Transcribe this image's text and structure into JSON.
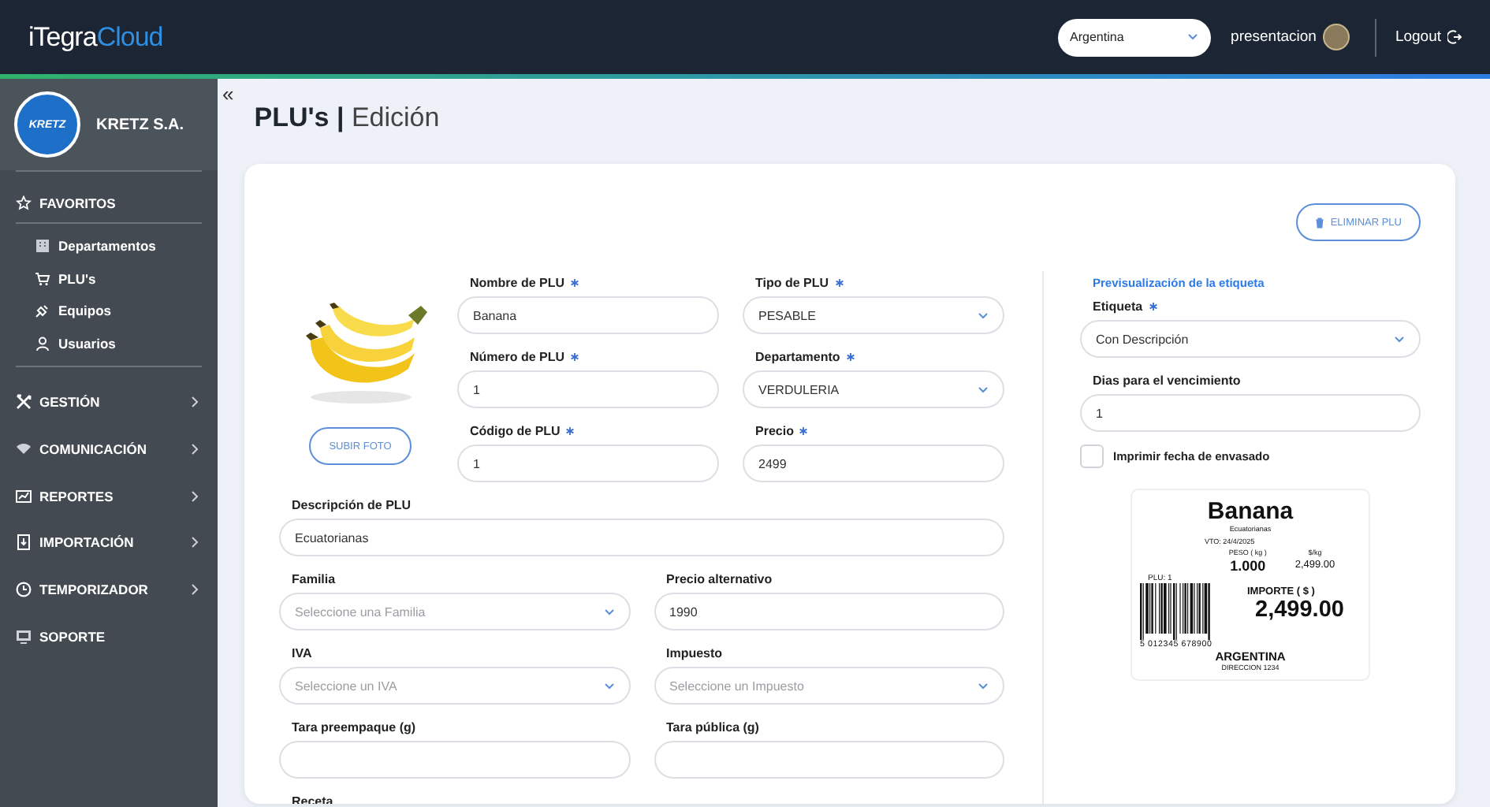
{
  "header": {
    "logo": {
      "primary": "iTegra",
      "secondary": "Cloud"
    },
    "country_select": {
      "value": "Argentina"
    },
    "user": {
      "name": "presentacion"
    },
    "logout": "Logout"
  },
  "sidebar": {
    "company": {
      "badge": "KRETZ",
      "name": "KRETZ S.A."
    },
    "favorites": {
      "title": "FAVORITOS",
      "items": [
        {
          "label": "Departamentos"
        },
        {
          "label": "PLU's"
        },
        {
          "label": "Equipos"
        },
        {
          "label": "Usuarios"
        }
      ]
    },
    "menu": [
      {
        "label": "GESTIÓN",
        "kind": "group"
      },
      {
        "label": "COMUNICACIÓN",
        "kind": "group"
      },
      {
        "label": "REPORTES",
        "kind": "group"
      },
      {
        "label": "IMPORTACIÓN",
        "kind": "group"
      },
      {
        "label": "TEMPORIZADOR",
        "kind": "group"
      },
      {
        "label": "SOPORTE",
        "kind": "link"
      }
    ]
  },
  "page": {
    "collapse_toggle": "«",
    "title": "PLU's |",
    "subtitle": "Edición"
  },
  "form": {
    "delete_button": "ELIMINAR PLU",
    "upload_button": "SUBIR FOTO",
    "fields": [
      {
        "label": "Nombre de PLU",
        "required": true,
        "kind": "input",
        "value": "Banana"
      },
      {
        "label": "Tipo de PLU",
        "required": true,
        "kind": "select",
        "value": "PESABLE"
      },
      {
        "label": "Número de PLU",
        "required": true,
        "kind": "input",
        "value": "1"
      },
      {
        "label": "Departamento",
        "required": true,
        "kind": "select",
        "value": "VERDULERIA"
      },
      {
        "label": "Código de PLU",
        "required": true,
        "kind": "input",
        "value": "1"
      },
      {
        "label": "Precio",
        "required": true,
        "kind": "input",
        "value": "2499"
      }
    ],
    "description": {
      "label": "Descripción de PLU",
      "required": false,
      "kind": "input",
      "value": "Ecuatorianas"
    },
    "details": [
      {
        "label": "Familia",
        "required": false,
        "kind": "select",
        "placeholder": "Seleccione una Familia"
      },
      {
        "label": "Precio alternativo",
        "required": false,
        "kind": "input",
        "value": "1990"
      },
      {
        "label": "IVA",
        "required": false,
        "kind": "select",
        "placeholder": "Seleccione un IVA"
      },
      {
        "label": "Impuesto",
        "required": false,
        "kind": "select",
        "placeholder": "Seleccione un Impuesto"
      },
      {
        "label": "Tara preempaque (g)",
        "required": false,
        "kind": "input"
      },
      {
        "label": "Tara pública (g)",
        "required": false,
        "kind": "input"
      },
      {
        "label": "Receta",
        "required": false,
        "kind": "label"
      }
    ]
  },
  "preview": {
    "heading": "Previsualización de la etiqueta",
    "fields": [
      {
        "label": "Etiqueta",
        "required": true,
        "kind": "select",
        "value": "Con Descripción"
      },
      {
        "label": "Dias para el vencimiento",
        "required": false,
        "kind": "input",
        "value": "1"
      }
    ],
    "print_date": {
      "label": "Imprimir fecha de envasado",
      "checked": false
    },
    "label": {
      "title": "Banana",
      "description": "Ecuatorianas",
      "expiry": "VTO: 24/4/2025",
      "weight_label": "PESO ( kg )",
      "weight": "1.000",
      "unit_price_label": "$/kg",
      "unit_price": "2,499.00",
      "plu": "PLU: 1",
      "total_label": "IMPORTE ( $ )",
      "total": "2,499.00",
      "barcode_number": "5 012345 678900",
      "store": "ARGENTINA",
      "address": "DIRECCION 1234"
    }
  }
}
